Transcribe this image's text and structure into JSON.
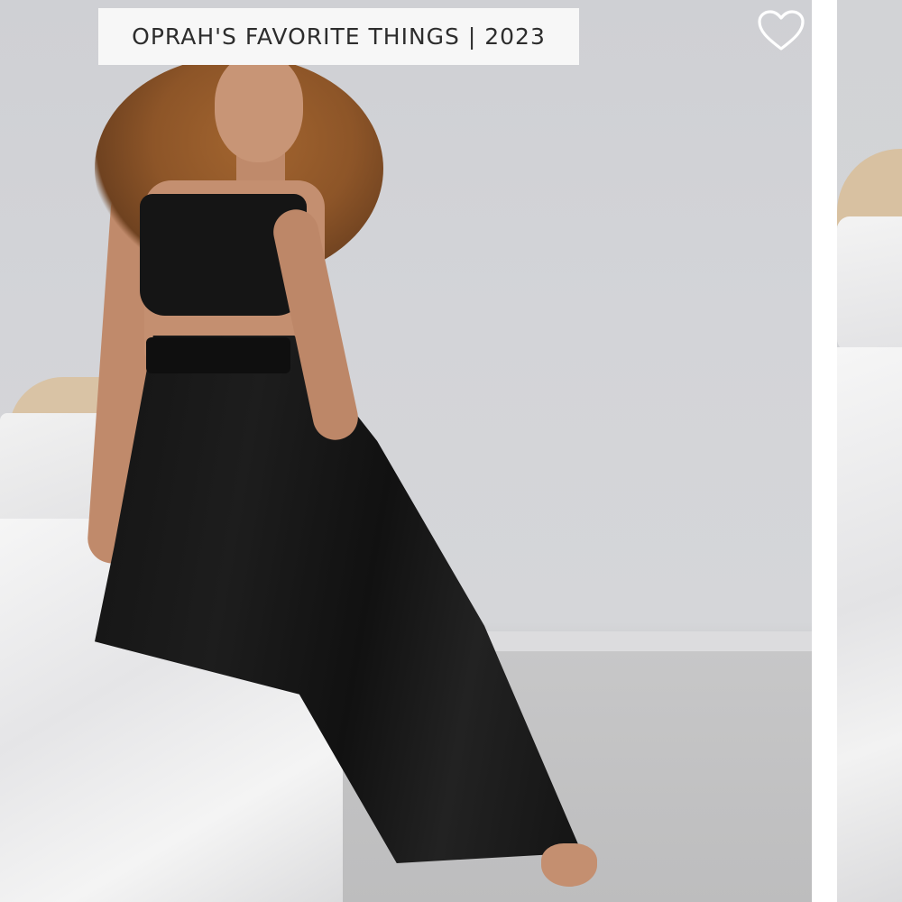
{
  "product_card": {
    "badge_text": "OPRAH'S FAVORITE THINGS | 2023",
    "wishlist_icon": "heart-outline-icon",
    "colors": {
      "badge_bg": "#f7f7f7",
      "badge_text": "#2d2d2d",
      "icon": "#ffffff"
    }
  },
  "next_card": {
    "visible": "partial"
  }
}
